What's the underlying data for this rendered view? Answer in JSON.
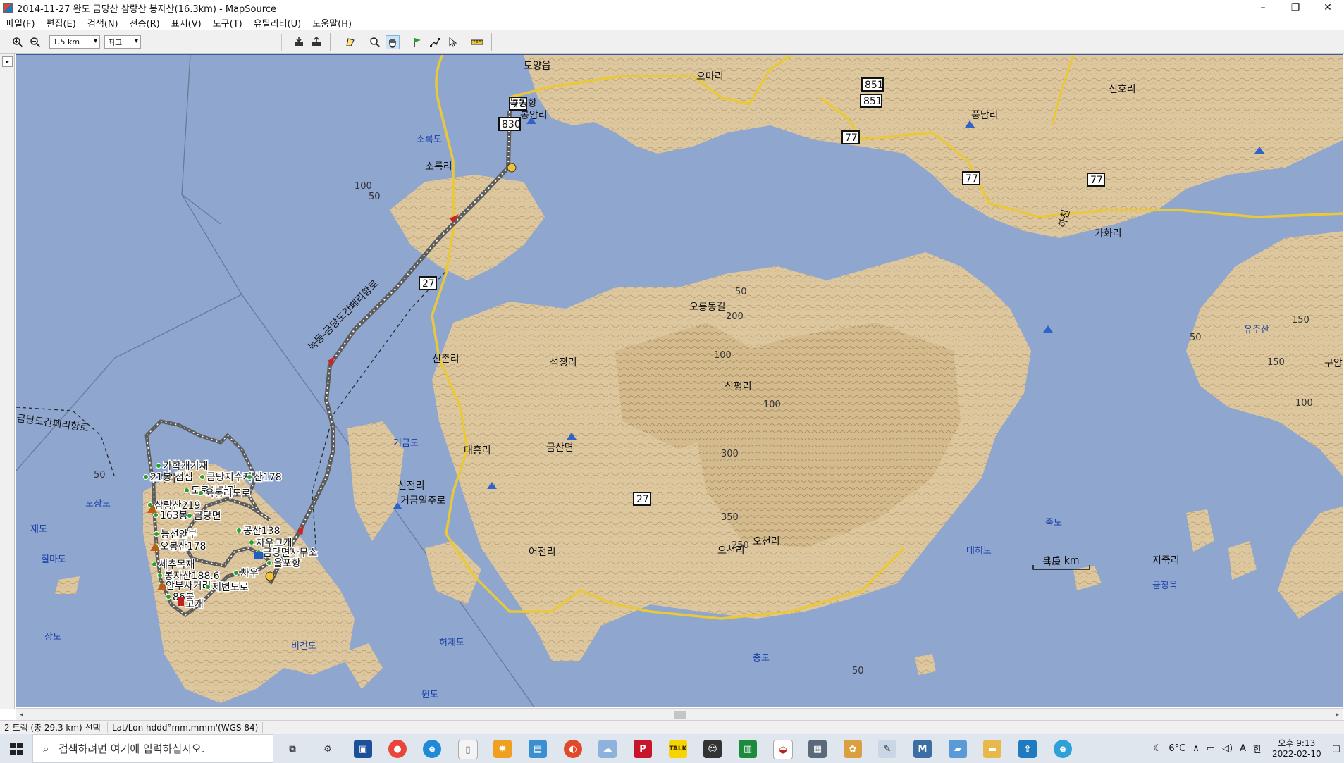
{
  "window": {
    "title": "2014-11-27 완도 금당산 삼랑산 봉자산(16.3km) - MapSource",
    "controls": [
      "–",
      "❐",
      "✕"
    ]
  },
  "menu": [
    "파일(F)",
    "편집(E)",
    "검색(N)",
    "전송(R)",
    "표시(V)",
    "도구(T)",
    "유틸리티(U)",
    "도움말(H)"
  ],
  "toolbar": {
    "zoom_value": "1.5 km",
    "detail_value": "최고"
  },
  "map": {
    "place_labels": [
      "도양읍",
      "오마리",
      "녹동항",
      "봉암리",
      "소록도",
      "소록리",
      "풍남리",
      "신호리",
      "하천",
      "가화리",
      "유주산",
      "구암",
      "오룡동길",
      "석정리",
      "신촌리",
      "거금도",
      "대흥리",
      "금산면",
      "신평리",
      "신전리",
      "거금일주로",
      "어전리",
      "오천리",
      "오천리",
      "금당도간페리항로",
      "녹동-금당도간페리항로",
      "도장도",
      "재도",
      "질마도",
      "장도",
      "비견도",
      "허제도",
      "대허도",
      "죽도",
      "목도",
      "지죽리",
      "금장욱",
      "충도",
      "원도",
      "가학리",
      "1.5 km"
    ],
    "waypoints": [
      "가학개기재",
      "금당저수지",
      "산178",
      "21봉 점심",
      "도로사거리",
      "육동리도로",
      "삼랑산219",
      "163봉",
      "금당면",
      "능선안부",
      "오봉산178",
      "공산138",
      "차우고개",
      "금당면사무소",
      "울포항",
      "세추목재",
      "봉자산188.6",
      "안부사거리",
      "86봉",
      "제변도로",
      "고개",
      "차우"
    ],
    "route_shields": [
      "77",
      "830",
      "851",
      "851",
      "77",
      "77",
      "77",
      "27",
      "27"
    ],
    "contour_values": [
      "100",
      "50",
      "50",
      "100",
      "200",
      "50",
      "100",
      "300",
      "350",
      "250",
      "150",
      "150",
      "100",
      "50",
      "50"
    ]
  },
  "status": {
    "selection": "2 트랙 (총 29.3 km) 선택",
    "coords_format": "Lat/Lon hddd°mm.mmm'(WGS 84)"
  },
  "taskbar": {
    "search_placeholder": "검색하려면 여기에 입력하십시오.",
    "weather": "6°C",
    "ime_lang": "A",
    "ime_mode": "한",
    "time": "오후 9:13",
    "date": "2022-02-10"
  },
  "colors": {
    "sea": "#8fa6cf",
    "land": "#dcc79f",
    "land_dark": "#c9ae80",
    "road": "#e9c93a",
    "track": "#6a6a6a",
    "window_bg": "#f0f0f0",
    "taskbar_bg": "#dfe6ee"
  }
}
